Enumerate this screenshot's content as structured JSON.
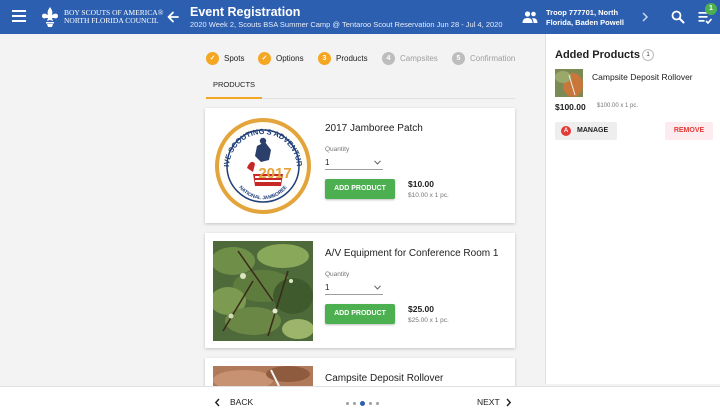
{
  "header": {
    "org_line1": "BOY SCOUTS OF AMERICA®",
    "org_line2": "NORTH FLORIDA COUNCIL",
    "title": "Event Registration",
    "subtitle": "2020 Week 2, Scouts BSA Summer Camp @ Tentaroo Scout Reservation Jun 28 - Jul 4, 2020",
    "troop_line1": "Troop 777701, North",
    "troop_line2": "Florida, Baden Powell",
    "cart_count": "1",
    "icons": [
      "menu-icon",
      "bsa-logo",
      "back-arrow-icon",
      "people-icon",
      "chevron-right-icon",
      "search-icon",
      "cart-icon"
    ]
  },
  "stepper": {
    "steps": [
      {
        "label": "Spots",
        "state": "done",
        "marker": "✓"
      },
      {
        "label": "Options",
        "state": "done",
        "marker": "✓"
      },
      {
        "label": "Products",
        "state": "active",
        "marker": "3"
      },
      {
        "label": "Campsites",
        "state": "pending",
        "marker": "4"
      },
      {
        "label": "Confirmation",
        "state": "pending",
        "marker": "5"
      }
    ],
    "done_color": "#f5a623",
    "pending_color": "#bdbdbd"
  },
  "tabs": {
    "products": "PRODUCTS"
  },
  "products": [
    {
      "name": "2017 Jamboree Patch",
      "quantity_label": "Quantity",
      "quantity": "1",
      "add_label": "ADD PRODUCT",
      "price": "$10.00",
      "price_detail": "$10.00 x 1 pc.",
      "patch_text_top": "LIVE SCOUTING'S ADVENTURE",
      "patch_year": "2017",
      "patch_text_bottom": "NATIONAL JAMBOREE"
    },
    {
      "name": "A/V Equipment for Conference Room 1",
      "quantity_label": "Quantity",
      "quantity": "1",
      "add_label": "ADD PRODUCT",
      "price": "$25.00",
      "price_detail": "$25.00 x 1 pc."
    },
    {
      "name": "Campsite Deposit Rollover"
    }
  ],
  "added_panel": {
    "title": "Added Products",
    "count": "1",
    "item_name": "Campsite Deposit Rollover",
    "price": "$100.00",
    "price_detail": "$100.00 x 1 pc.",
    "manage_label": "MANAGE",
    "manage_icon_letter": "A",
    "remove_label": "REMOVE"
  },
  "footer": {
    "back_label": "BACK",
    "next_label": "NEXT",
    "page_dots": 5,
    "active_dot": 3
  },
  "colors": {
    "header_bg": "#2d5fb0",
    "accent": "#f5a623",
    "add_button": "#4caf50",
    "remove_text": "#e53935"
  }
}
